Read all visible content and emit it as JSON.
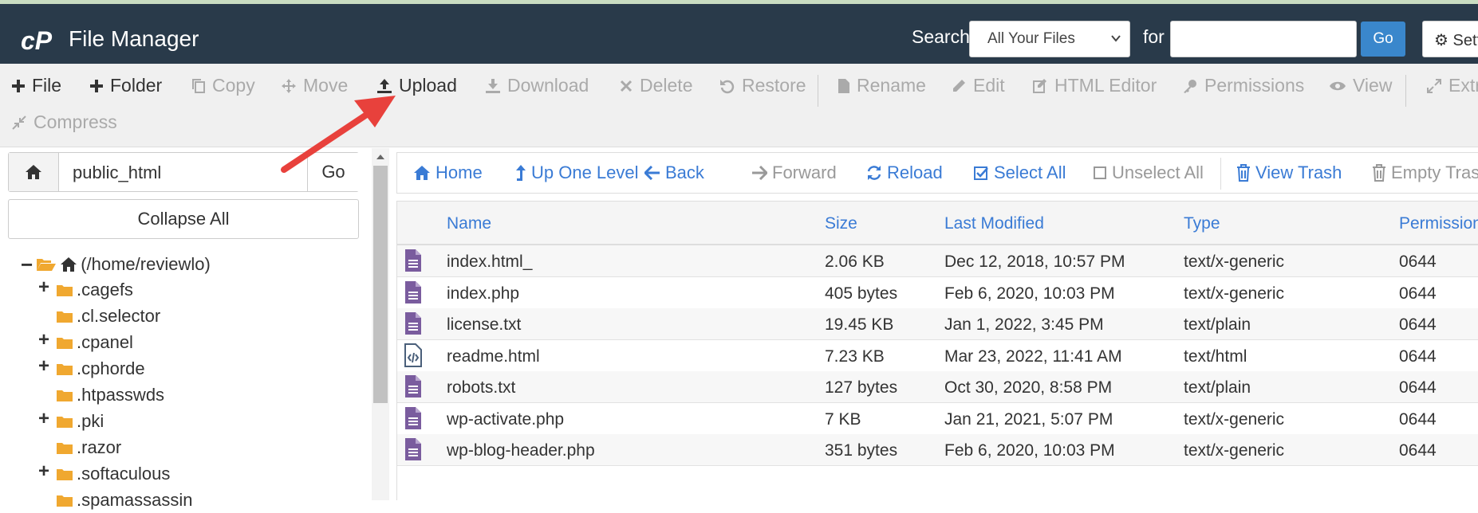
{
  "header": {
    "app_title": "File Manager",
    "search_label": "Search",
    "search_scope": "All Your Files",
    "for_label": "for",
    "search_value": "",
    "go_label": "Go",
    "settings_label": "Settings"
  },
  "toolbar": {
    "file": "File",
    "folder": "Folder",
    "copy": "Copy",
    "move": "Move",
    "upload": "Upload",
    "download": "Download",
    "delete": "Delete",
    "restore": "Restore",
    "rename": "Rename",
    "edit": "Edit",
    "html_editor": "HTML Editor",
    "permissions": "Permissions",
    "view": "View",
    "extract": "Extract",
    "compress": "Compress"
  },
  "sidebar": {
    "path": "public_html",
    "go_label": "Go",
    "collapse_all": "Collapse All",
    "root": "(/home/reviewlo)",
    "items": [
      {
        "label": ".cagefs",
        "expandable": true
      },
      {
        "label": ".cl.selector",
        "expandable": false
      },
      {
        "label": ".cpanel",
        "expandable": true
      },
      {
        "label": ".cphorde",
        "expandable": true
      },
      {
        "label": ".htpasswds",
        "expandable": false
      },
      {
        "label": ".pki",
        "expandable": true
      },
      {
        "label": ".razor",
        "expandable": false
      },
      {
        "label": ".softaculous",
        "expandable": true
      },
      {
        "label": ".spamassassin",
        "expandable": false
      }
    ]
  },
  "navbar": {
    "home": "Home",
    "up_one_level": "Up One Level",
    "back": "Back",
    "forward": "Forward",
    "reload": "Reload",
    "select_all": "Select All",
    "unselect_all": "Unselect All",
    "view_trash": "View Trash",
    "empty_trash": "Empty Trash"
  },
  "table": {
    "columns": [
      "Name",
      "Size",
      "Last Modified",
      "Type",
      "Permissions"
    ],
    "rows": [
      {
        "name": "index.html_",
        "size": "2.06 KB",
        "modified": "Dec 12, 2018, 10:57 PM",
        "type": "text/x-generic",
        "perms": "0644",
        "icon": "text-file-icon"
      },
      {
        "name": "index.php",
        "size": "405 bytes",
        "modified": "Feb 6, 2020, 10:03 PM",
        "type": "text/x-generic",
        "perms": "0644",
        "icon": "text-file-icon"
      },
      {
        "name": "license.txt",
        "size": "19.45 KB",
        "modified": "Jan 1, 2022, 3:45 PM",
        "type": "text/plain",
        "perms": "0644",
        "icon": "text-file-icon"
      },
      {
        "name": "readme.html",
        "size": "7.23 KB",
        "modified": "Mar 23, 2022, 11:41 AM",
        "type": "text/html",
        "perms": "0644",
        "icon": "code-file-icon"
      },
      {
        "name": "robots.txt",
        "size": "127 bytes",
        "modified": "Oct 30, 2020, 8:58 PM",
        "type": "text/plain",
        "perms": "0644",
        "icon": "text-file-icon"
      },
      {
        "name": "wp-activate.php",
        "size": "7 KB",
        "modified": "Jan 21, 2021, 5:07 PM",
        "type": "text/x-generic",
        "perms": "0644",
        "icon": "text-file-icon"
      },
      {
        "name": "wp-blog-header.php",
        "size": "351 bytes",
        "modified": "Feb 6, 2020, 10:03 PM",
        "type": "text/x-generic",
        "perms": "0644",
        "icon": "text-file-icon"
      }
    ]
  },
  "colors": {
    "header_bg": "#293a4a",
    "accent_blue": "#3a7bd5",
    "folder": "#f0a830",
    "file_icon": "#7a5c9e",
    "annotation_arrow": "#e8413c"
  }
}
